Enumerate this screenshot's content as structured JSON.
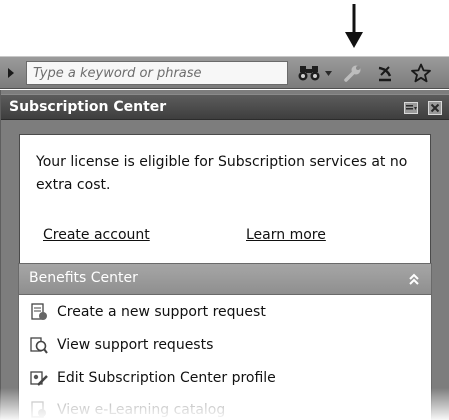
{
  "search": {
    "placeholder": "Type a keyword or phrase"
  },
  "toolbar_icons": [
    "expand-arrow-icon",
    "binoculars-icon",
    "dropdown-icon",
    "wrench-icon",
    "satellite-dish-icon",
    "star-icon"
  ],
  "panel": {
    "title": "Subscription Center",
    "controls": [
      "panel-options-icon",
      "close-icon"
    ]
  },
  "license": {
    "message": "Your license is eligible for Subscription services at no extra cost.",
    "create_account": "Create account",
    "learn_more": "Learn more"
  },
  "benefits": {
    "title": "Benefits Center",
    "items": [
      {
        "label": "Create a new support request",
        "icon": "support-request-icon"
      },
      {
        "label": "View support requests",
        "icon": "view-requests-icon"
      },
      {
        "label": "Edit Subscription Center profile",
        "icon": "edit-profile-icon"
      },
      {
        "label": "View e-Learning catalog",
        "icon": "elearning-icon"
      }
    ]
  },
  "colors": {
    "toolbar": "#8a8a8a",
    "panel_bg": "#7d7d7d",
    "titlebar": "#4a4a4a",
    "section_header": "#999999"
  }
}
